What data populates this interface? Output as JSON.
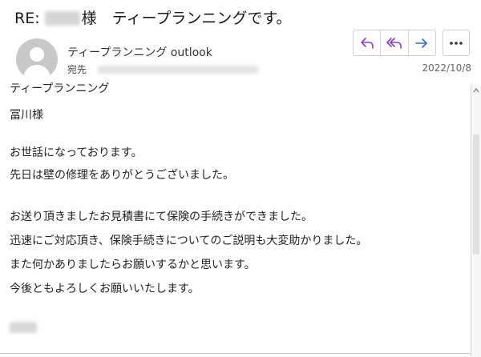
{
  "subject": {
    "prefix": "RE:",
    "suffix": "様　ティープランニングです。"
  },
  "header": {
    "sender": "ティープランニング outlook",
    "to_label": "宛先",
    "date": "2022/10/8",
    "buttons": {
      "reply": "reply-icon",
      "reply_all": "reply-all-icon",
      "forward": "forward-icon",
      "more": "more-icon"
    },
    "colors": {
      "reply_icons": "#8a3fbf",
      "forward_icon": "#2b6fc4"
    }
  },
  "body": {
    "lines": [
      "ティープランニング",
      "冨川様",
      "お世話になっております。",
      "先日は壁の修理をありがとうございました。",
      "お送り頂きましたお見積書にて保険の手続きができました。",
      "迅速にご対応頂き、保険手続きについてのご説明も大変助かりました。",
      "また何かありましたらお願いするかと思います。",
      "今後ともよろしくお願いいたします。"
    ]
  }
}
